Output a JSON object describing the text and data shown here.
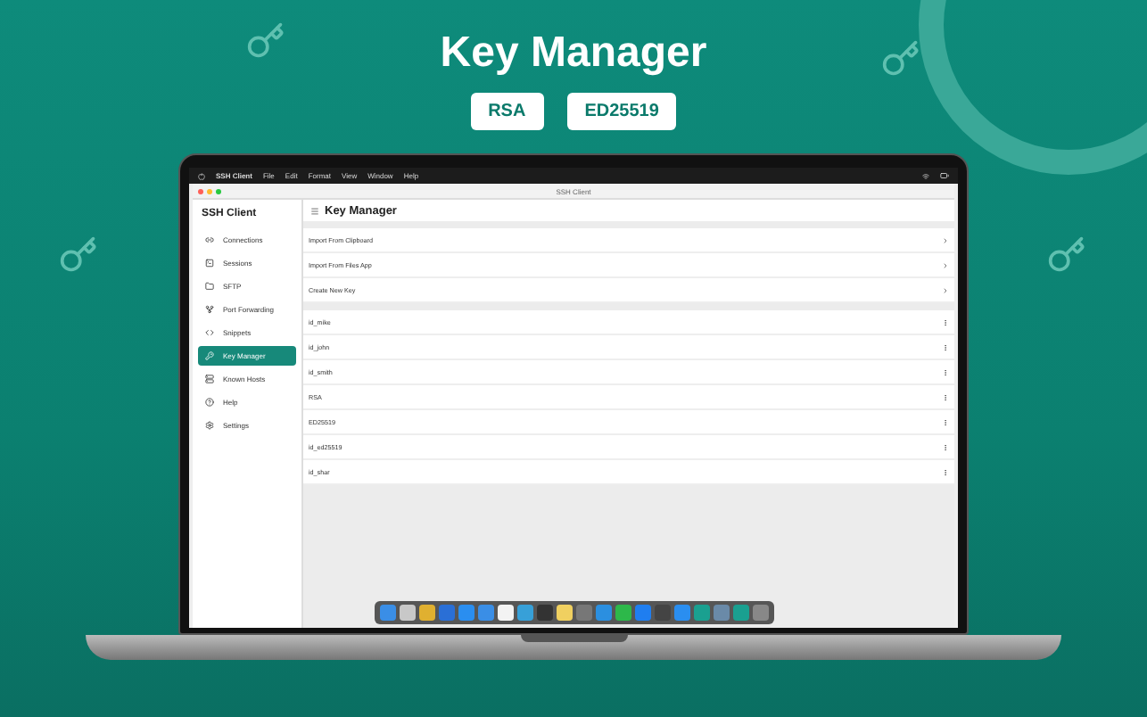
{
  "headline": "Key Manager",
  "key_types": [
    {
      "label": "RSA"
    },
    {
      "label": "ED25519"
    }
  ],
  "menu_bar": {
    "app": "SSH Client",
    "items": [
      "File",
      "Edit",
      "Format",
      "View",
      "Window",
      "Help"
    ]
  },
  "window": {
    "title": "SSH Client"
  },
  "sidebar": {
    "title": "SSH Client",
    "items": [
      {
        "label": "Connections",
        "kind": "link",
        "selected": false
      },
      {
        "label": "Sessions",
        "kind": "terminal",
        "selected": false
      },
      {
        "label": "SFTP",
        "kind": "folder",
        "selected": false
      },
      {
        "label": "Port Forwarding",
        "kind": "fork",
        "selected": false
      },
      {
        "label": "Snippets",
        "kind": "code",
        "selected": false
      },
      {
        "label": "Key Manager",
        "kind": "key",
        "selected": true
      },
      {
        "label": "Known Hosts",
        "kind": "server",
        "selected": false
      },
      {
        "label": "Help",
        "kind": "help",
        "selected": false
      },
      {
        "label": "Settings",
        "kind": "settings",
        "selected": false
      }
    ]
  },
  "page": {
    "title": "Key Manager",
    "actions": [
      "Import From Clipboard",
      "Import From Files App",
      "Create New Key"
    ],
    "keys": [
      "id_mike",
      "id_john",
      "id_smith",
      "RSA",
      "ED25519",
      "id_ed25519",
      "id_shar"
    ]
  }
}
